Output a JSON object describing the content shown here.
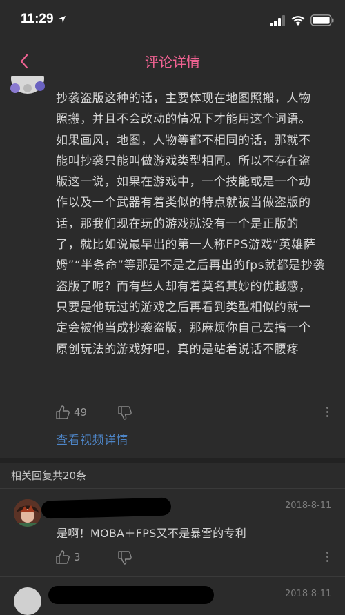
{
  "status_bar": {
    "time": "11:29"
  },
  "nav": {
    "title": "评论详情"
  },
  "comment": {
    "lines": [
      "抄袭盗版这种的话，主要体现在地图照搬，人物",
      "照搬，并且不会改动的情况下才能用这个词语。",
      "如果画风，地图，人物等都不相同的话，那就不",
      "能叫抄袭只能叫做游戏类型相同。所以不存在盗",
      "版这一说，如果在游戏中，一个技能或是一个动",
      "作以及一个武器有着类似的特点就被当做盗版的",
      "话，那我们现在玩的游戏就没有一个是正版的",
      "了，就比如说最早出的第一人称FPS游戏“英雄萨",
      "姆”“半条命”等那是不是之后再出的fps就都是抄袭",
      "盗版了呢？而有些人却有着莫名其妙的优越感，",
      "只要是他玩过的游戏之后再看到类型相似的就一",
      "定会被他当成抄袭盗版，那麻烦你自己去搞一个",
      "原创玩法的游戏好吧，真的是站着说话不腰疼"
    ],
    "like_count": "49",
    "view_details": "查看视频详情"
  },
  "replies": {
    "header": "相关回复共20条",
    "items": [
      {
        "date": "2018-8-11",
        "text": "是啊！MOBA＋FPS又不是暴雪的专利",
        "like_count": "3"
      },
      {
        "date": "2018-8-11"
      }
    ]
  },
  "colors": {
    "accent": "#f06292",
    "link": "#4e86c8",
    "background": "#2b2b2b"
  }
}
